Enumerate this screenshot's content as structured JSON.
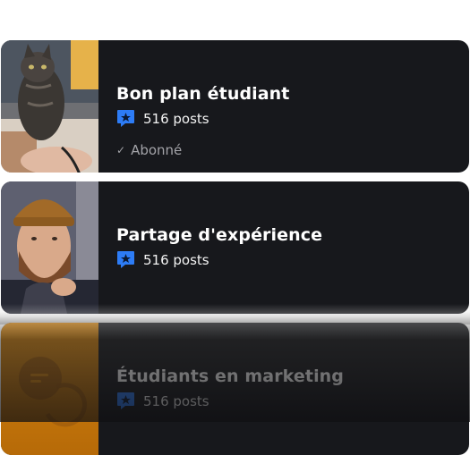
{
  "communities": [
    {
      "title": "Bon plan étudiant",
      "posts": "516 posts",
      "status": "Abonné",
      "image": "cat-photo"
    },
    {
      "title": "Partage d'expérience",
      "posts": "516 posts",
      "image": "bearded-man-photo"
    },
    {
      "title": "Étudiants en marketing",
      "posts": "516 posts",
      "image": "chat-bubble-placeholder"
    }
  ],
  "colors": {
    "card": "#17181c",
    "accent": "#2d7cf6",
    "placeholder": "#c77a10"
  }
}
